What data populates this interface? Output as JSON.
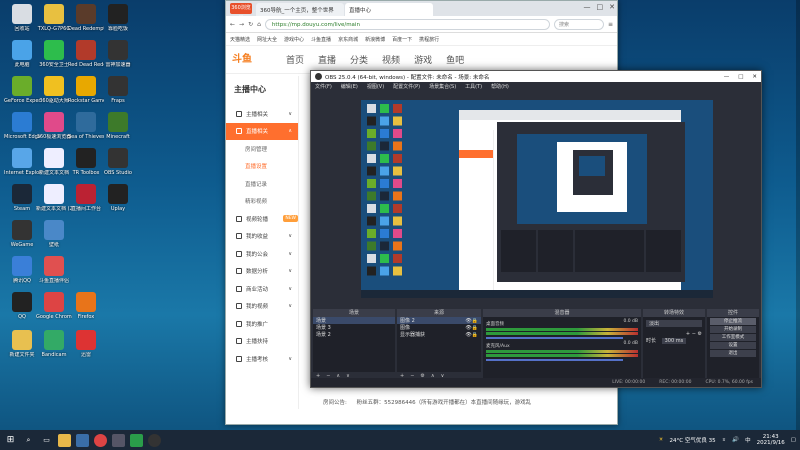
{
  "desktop_icons": [
    {
      "label": "回收站",
      "color": "#d9dde3"
    },
    {
      "label": "TXLQ-G7P6G",
      "color": "#e8c040"
    },
    {
      "label": "Dead Redemption",
      "color": "#5a3b2a"
    },
    {
      "label": "靠脸吃饭",
      "color": "#222"
    },
    {
      "label": "此电脑",
      "color": "#4aa3e8"
    },
    {
      "label": "360安全卫士",
      "color": "#2dbd4c"
    },
    {
      "label": "Red Dead Redemption",
      "color": "#b23a2a"
    },
    {
      "label": "雷神加速器",
      "color": "#333"
    },
    {
      "label": "GeForce Experience",
      "color": "#6aad2a"
    },
    {
      "label": "360驱动大师",
      "color": "#f0c020"
    },
    {
      "label": "Rockstar Games",
      "color": "#e8a800"
    },
    {
      "label": "Fraps",
      "color": "#333"
    },
    {
      "label": "Microsoft Edge",
      "color": "#2b7cd3"
    },
    {
      "label": "360极速浏览器",
      "color": "#e04a8a"
    },
    {
      "label": "Sea of Thieves",
      "color": "#2f6b9c"
    },
    {
      "label": "Minecraft",
      "color": "#3d7a2a"
    },
    {
      "label": "Internet Explorer",
      "color": "#58a6e8"
    },
    {
      "label": "新建文本文档",
      "color": "#eef"
    },
    {
      "label": "TR Toolbox",
      "color": "#222"
    },
    {
      "label": "OBS Studio",
      "color": "#333"
    },
    {
      "label": "Steam",
      "color": "#1b2838"
    },
    {
      "label": "新建文本文档 (2)",
      "color": "#eef"
    },
    {
      "label": "直播间工作台",
      "color": "#b23"
    },
    {
      "label": "Uplay",
      "color": "#222"
    },
    {
      "label": "WeGame",
      "color": "#333"
    },
    {
      "label": "壁纸",
      "color": "#4a88c8"
    },
    {
      "label": "腾讯QQ",
      "color": "#3a7fd8"
    },
    {
      "label": "斗鱼直播伴侣",
      "color": "#e05050"
    },
    {
      "label": "QQ",
      "color": "#222"
    },
    {
      "label": "Google Chrome",
      "color": "#d44"
    },
    {
      "label": "Firefox",
      "color": "#e8741a"
    },
    {
      "label": "新建文件夹",
      "color": "#e8c050"
    },
    {
      "label": "Bandicam",
      "color": "#3a6"
    },
    {
      "label": "迅雷",
      "color": "#d33"
    }
  ],
  "browser": {
    "brand": "360浏览器",
    "tabs": [
      "360导航_一个主页，整个世界",
      "直播中心"
    ],
    "url": "https://mp.douyu.com/live/main",
    "search_placeholder": "搜索",
    "bookmarks": [
      "天猫精选",
      "网址大全",
      "游戏中心",
      "斗鱼直播",
      "京东商城",
      "新浪微博",
      "百度一下",
      "携程旅行"
    ],
    "nav": {
      "logo": "斗鱼",
      "items": [
        "首页",
        "直播",
        "分类",
        "视频",
        "游戏",
        "鱼吧"
      ]
    },
    "sidebar": {
      "title": "主播中心",
      "items": [
        {
          "label": "主播相关",
          "type": "top",
          "arrow": "∨"
        },
        {
          "label": "直播相关",
          "type": "active",
          "arrow": "∧"
        },
        {
          "label": "房间管理",
          "type": "sub"
        },
        {
          "label": "直播设置",
          "type": "subact"
        },
        {
          "label": "直播记录",
          "type": "sub"
        },
        {
          "label": "精彩视频",
          "type": "sub"
        },
        {
          "label": "视频轮播",
          "type": "top",
          "badge": "NEW"
        },
        {
          "label": "我的收益",
          "type": "top",
          "arrow": "∨"
        },
        {
          "label": "我的公会",
          "type": "top",
          "arrow": "∨"
        },
        {
          "label": "数据分析",
          "type": "top",
          "arrow": "∨"
        },
        {
          "label": "商业活动",
          "type": "top",
          "arrow": "∨"
        },
        {
          "label": "我的视频",
          "type": "top",
          "arrow": "∨"
        },
        {
          "label": "我的推广",
          "type": "top"
        },
        {
          "label": "主播扶持",
          "type": "top"
        },
        {
          "label": "主播考核",
          "type": "top",
          "arrow": "∨"
        }
      ]
    },
    "footer": {
      "label": "房间公告:",
      "text": "粉丝五群：552986446（所有游戏开播都在）本直播间随缘玩，游戏乱"
    }
  },
  "obs": {
    "title": "OBS 25.0.4 (64-bit, windows) - 配置文件: 未命名 - 场景: 未命名",
    "menu": [
      "文件(F)",
      "编辑(E)",
      "视图(V)",
      "配置文件(P)",
      "场景集合(S)",
      "工具(T)",
      "帮助(H)"
    ],
    "docks": {
      "scenes": {
        "header": "场景",
        "items": [
          "场景",
          "场景 3",
          "场景 2"
        ]
      },
      "sources": {
        "header": "来源",
        "items": [
          "图像 2",
          "图像",
          "显示器捕获"
        ]
      },
      "mixer": {
        "header": "混音器",
        "channels": [
          {
            "name": "桌面音频",
            "db": "0.0 dB"
          },
          {
            "name": "麦克风/Aux",
            "db": "0.0 dB"
          }
        ]
      },
      "transitions": {
        "header": "转场特效",
        "type": "淡出",
        "duration_label": "时长",
        "duration": "300 ms"
      },
      "controls": {
        "header": "控件",
        "buttons": [
          "停止推流",
          "开始录制",
          "工作室模式",
          "设置",
          "退出"
        ]
      }
    },
    "status": [
      "LIVE: 00:00:00",
      "REC: 00:00:00",
      "CPU: 0.7%, 60.00 fps"
    ]
  },
  "taskbar": {
    "weather": "24°C 空气优良 35",
    "time": "21:43",
    "date": "2021/9/16",
    "lang": "中"
  }
}
